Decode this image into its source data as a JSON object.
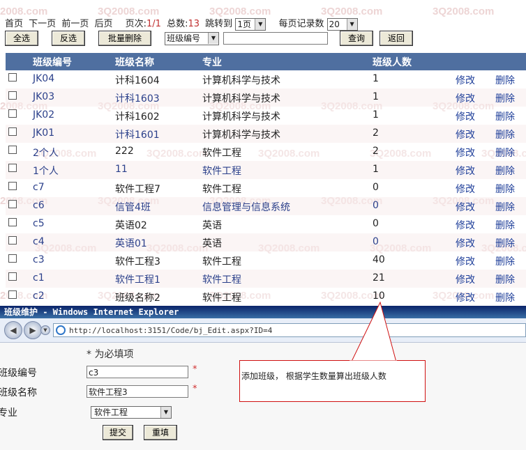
{
  "pager": {
    "first": "首页",
    "next": "下一页",
    "prev": "前一页",
    "last": "后页",
    "page_label": "页次:",
    "page_value": "1/1",
    "total_label": "总数:",
    "total_value": "13",
    "goto_label": "跳转到",
    "goto_value": "1页",
    "per_page_label": "每页记录数",
    "per_page_value": "20"
  },
  "toolbar": {
    "select_all": "全选",
    "invert": "反选",
    "batch_delete": "批量删除",
    "search_field": "班级编号",
    "search_value": "",
    "query": "查询",
    "back": "返回"
  },
  "table": {
    "headers": [
      "班级编号",
      "班级名称",
      "专业",
      "班级人数"
    ],
    "edit_label": "修改",
    "delete_label": "删除",
    "rows": [
      {
        "id": "JK04",
        "name": "计科1604",
        "major": "计算机科学与技术",
        "count": "1"
      },
      {
        "id": "JK03",
        "name": "计科1603",
        "major": "计算机科学与技术",
        "count": "1"
      },
      {
        "id": "JK02",
        "name": "计科1602",
        "major": "计算机科学与技术",
        "count": "1"
      },
      {
        "id": "JK01",
        "name": "计科1601",
        "major": "计算机科学与技术",
        "count": "2"
      },
      {
        "id": "2个人",
        "name": "222",
        "major": "软件工程",
        "count": "2"
      },
      {
        "id": "1个人",
        "name": "11",
        "major": "软件工程",
        "count": "1"
      },
      {
        "id": "c7",
        "name": "软件工程7",
        "major": "软件工程",
        "count": "0"
      },
      {
        "id": "c6",
        "name": "信管4班",
        "major": "信息管理与信息系统",
        "count": "0"
      },
      {
        "id": "c5",
        "name": "英语02",
        "major": "英语",
        "count": "0"
      },
      {
        "id": "c4",
        "name": "英语01",
        "major": "英语",
        "count": "0"
      },
      {
        "id": "c3",
        "name": "软件工程3",
        "major": "软件工程",
        "count": "40"
      },
      {
        "id": "c1",
        "name": "软件工程1",
        "major": "软件工程",
        "count": "21"
      },
      {
        "id": "c2",
        "name": "班级名称2",
        "major": "软件工程",
        "count": "10"
      }
    ]
  },
  "ie_window": {
    "title": "班级维护 - Windows Internet Explorer",
    "url": "http://localhost:3151/Code/bj_Edit.aspx?ID=4"
  },
  "edit_form": {
    "required_note": "* 为必填项",
    "class_id_label": "班级编号",
    "class_id_value": "c3",
    "class_name_label": "班级名称",
    "class_name_value": "软件工程3",
    "major_label": "专业",
    "major_value": "软件工程",
    "submit": "提交",
    "reset": "重填"
  },
  "callout": {
    "text": "添加班级， 根据学生数量算出班级人数"
  },
  "watermark": "3Q2008.com",
  "colors": {
    "header_bg": "#4f6fa0",
    "link": "#1f3f9a",
    "callout_border": "#d01010"
  }
}
